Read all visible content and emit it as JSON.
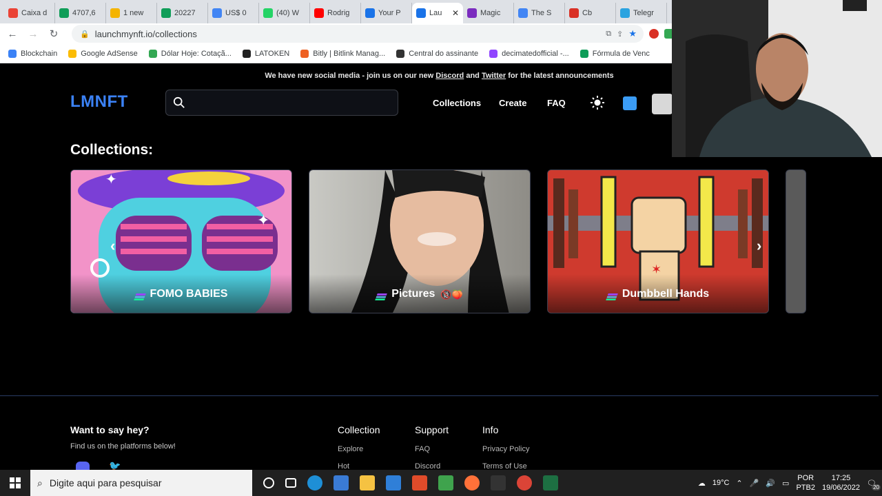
{
  "browser": {
    "tabs": [
      {
        "label": "Caixa d",
        "color": "#ea4335"
      },
      {
        "label": "4707,6",
        "color": "#0f9d58"
      },
      {
        "label": "1 new",
        "color": "#f4b400"
      },
      {
        "label": "20227",
        "color": "#0f9d58"
      },
      {
        "label": "US$ 0",
        "color": "#4285f4"
      },
      {
        "label": "(40) W",
        "color": "#25d366"
      },
      {
        "label": "Rodrig",
        "color": "#ff0000"
      },
      {
        "label": "Your P",
        "color": "#1a73e8"
      },
      {
        "label": "Lau",
        "color": "#1a73e8",
        "active": true
      },
      {
        "label": "Magic",
        "color": "#7b2cbf"
      },
      {
        "label": "The S",
        "color": "#4285f4"
      },
      {
        "label": "Cb",
        "color": "#d93025"
      },
      {
        "label": "Telegr",
        "color": "#2aa3e0"
      }
    ],
    "url": "launchmynft.io/collections",
    "bookmarks": [
      {
        "label": "Blockchain",
        "color": "#3b82f6"
      },
      {
        "label": "Google AdSense",
        "color": "#fbbc04"
      },
      {
        "label": "Dólar Hoje: Cotaçã...",
        "color": "#34a853"
      },
      {
        "label": "LATOKEN",
        "color": "#222222"
      },
      {
        "label": "Bitly | Bitlink Manag...",
        "color": "#ee6123"
      },
      {
        "label": "Central do assinante",
        "color": "#333333"
      },
      {
        "label": "decimatedofficial -...",
        "color": "#9146ff"
      },
      {
        "label": "Fórmula de Venc",
        "color": "#0f9d58"
      }
    ]
  },
  "site": {
    "announcement_prefix": "We have new social media - join us on our new ",
    "announcement_discord": "Discord",
    "announcement_and": " and ",
    "announcement_twitter": "Twitter",
    "announcement_suffix": " for the latest announcements",
    "logo": "LMNFT",
    "search_placeholder": "",
    "nav": {
      "collections": "Collections",
      "create": "Create",
      "faq": "FAQ"
    },
    "section_title": "Collections:",
    "collections": [
      {
        "name": "FOMO BABIES",
        "emoji": ""
      },
      {
        "name": "Pictures",
        "emoji": "🔞🍑"
      },
      {
        "name": "Dumbbell Hands",
        "emoji": ""
      }
    ],
    "footer": {
      "hey_title": "Want to say hey?",
      "hey_sub": "Find us on the platforms below!",
      "collection_title": "Collection",
      "collection_links": [
        "Explore",
        "Hot"
      ],
      "support_title": "Support",
      "support_links": [
        "FAQ",
        "Discord"
      ],
      "info_title": "Info",
      "info_links": [
        "Privacy Policy",
        "Terms of Use"
      ]
    }
  },
  "taskbar": {
    "search_placeholder": "Digite aqui para pesquisar",
    "weather": "19°C",
    "lang1": "POR",
    "lang2": "PTB2",
    "time": "17:25",
    "date": "19/06/2022",
    "notif_count": "20"
  },
  "colors": {
    "accent": "#3b82f6"
  }
}
